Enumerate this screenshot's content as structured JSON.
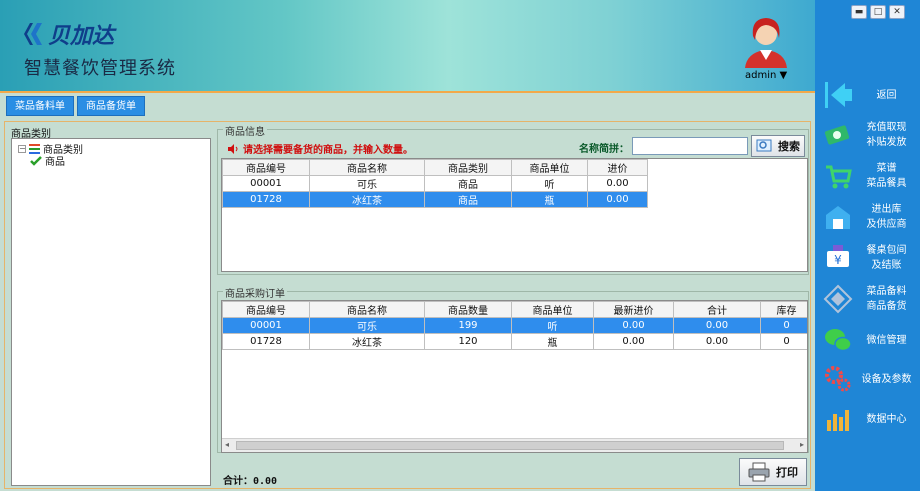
{
  "header": {
    "brand": "贝加达",
    "app_title": "智慧餐饮管理系统",
    "user": "admin ▼"
  },
  "window_controls": [
    "▬",
    "□",
    "✕"
  ],
  "tabs": [
    "菜品备料单",
    "商品备货单"
  ],
  "category": {
    "title": "商品类别",
    "root": "商品类别",
    "child": "商品"
  },
  "product_info": {
    "group_label": "商品信息",
    "prompt": "请选择需要备货的商品，并输入数量。",
    "search_label": "名称简拼：",
    "search_value": "",
    "search_button": "搜索",
    "columns": [
      "商品编号",
      "商品名称",
      "商品类别",
      "商品单位",
      "进价"
    ],
    "rows": [
      [
        "00001",
        "可乐",
        "商品",
        "听",
        "0.00"
      ],
      [
        "01728",
        "冰红茶",
        "商品",
        "瓶",
        "0.00"
      ]
    ],
    "selected_row": 1
  },
  "purchase_order": {
    "group_label": "商品采购订单",
    "columns": [
      "商品编号",
      "商品名称",
      "商品数量",
      "商品单位",
      "最新进价",
      "合计",
      "库存"
    ],
    "rows": [
      [
        "00001",
        "可乐",
        "199",
        "听",
        "0.00",
        "0.00",
        "0"
      ],
      [
        "01728",
        "冰红茶",
        "120",
        "瓶",
        "0.00",
        "0.00",
        "0"
      ]
    ],
    "selected_row": 0
  },
  "total_label": "合计：0.00",
  "print_button": "打印",
  "sidebar": {
    "items": [
      {
        "label": "返回",
        "icon": "back-arrow-icon"
      },
      {
        "label": "充值取现\n补贴发放",
        "icon": "money-icon"
      },
      {
        "label": "菜谱\n菜品餐具",
        "icon": "cart-icon"
      },
      {
        "label": "进出库\n及供应商",
        "icon": "warehouse-icon"
      },
      {
        "label": "餐桌包间\n及结账",
        "icon": "yen-card-icon"
      },
      {
        "label": "菜品备料\n商品备货",
        "icon": "diamond-icon"
      },
      {
        "label": "微信管理",
        "icon": "wechat-icon"
      },
      {
        "label": "设备及参数",
        "icon": "gears-icon"
      },
      {
        "label": "数据中心",
        "icon": "chart-icon"
      }
    ]
  }
}
